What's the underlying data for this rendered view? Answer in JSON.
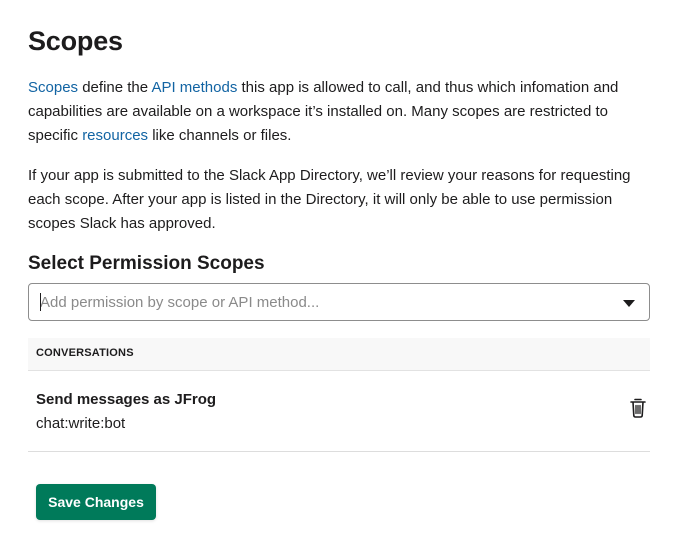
{
  "page": {
    "title": "Scopes"
  },
  "intro": {
    "link_scopes": "Scopes",
    "text_a": " define the ",
    "link_api_methods": "API methods",
    "text_b": " this app is allowed to call, and thus which infomation and capabilities are available on a workspace it’s installed on. Many scopes are restricted to specific ",
    "link_resources": "resources",
    "text_c": " like channels or files."
  },
  "review_note": "If your app is submitted to the Slack App Directory, we’ll review your reasons for requesting each scope. After your app is listed in the Directory, it will only be able to use permission scopes Slack has approved.",
  "permissions": {
    "heading": "Select Permission Scopes",
    "search_placeholder": "Add permission by scope or API method...",
    "search_value": "",
    "sections": [
      {
        "header": "CONVERSATIONS",
        "items": [
          {
            "name": "Send messages as JFrog",
            "scope": "chat:write:bot",
            "action_icon": "trash-icon"
          }
        ]
      }
    ]
  },
  "actions": {
    "save_label": "Save Changes",
    "save_color": "#007a5a"
  },
  "colors": {
    "link": "#1264a3",
    "text": "#1d1c1d"
  }
}
